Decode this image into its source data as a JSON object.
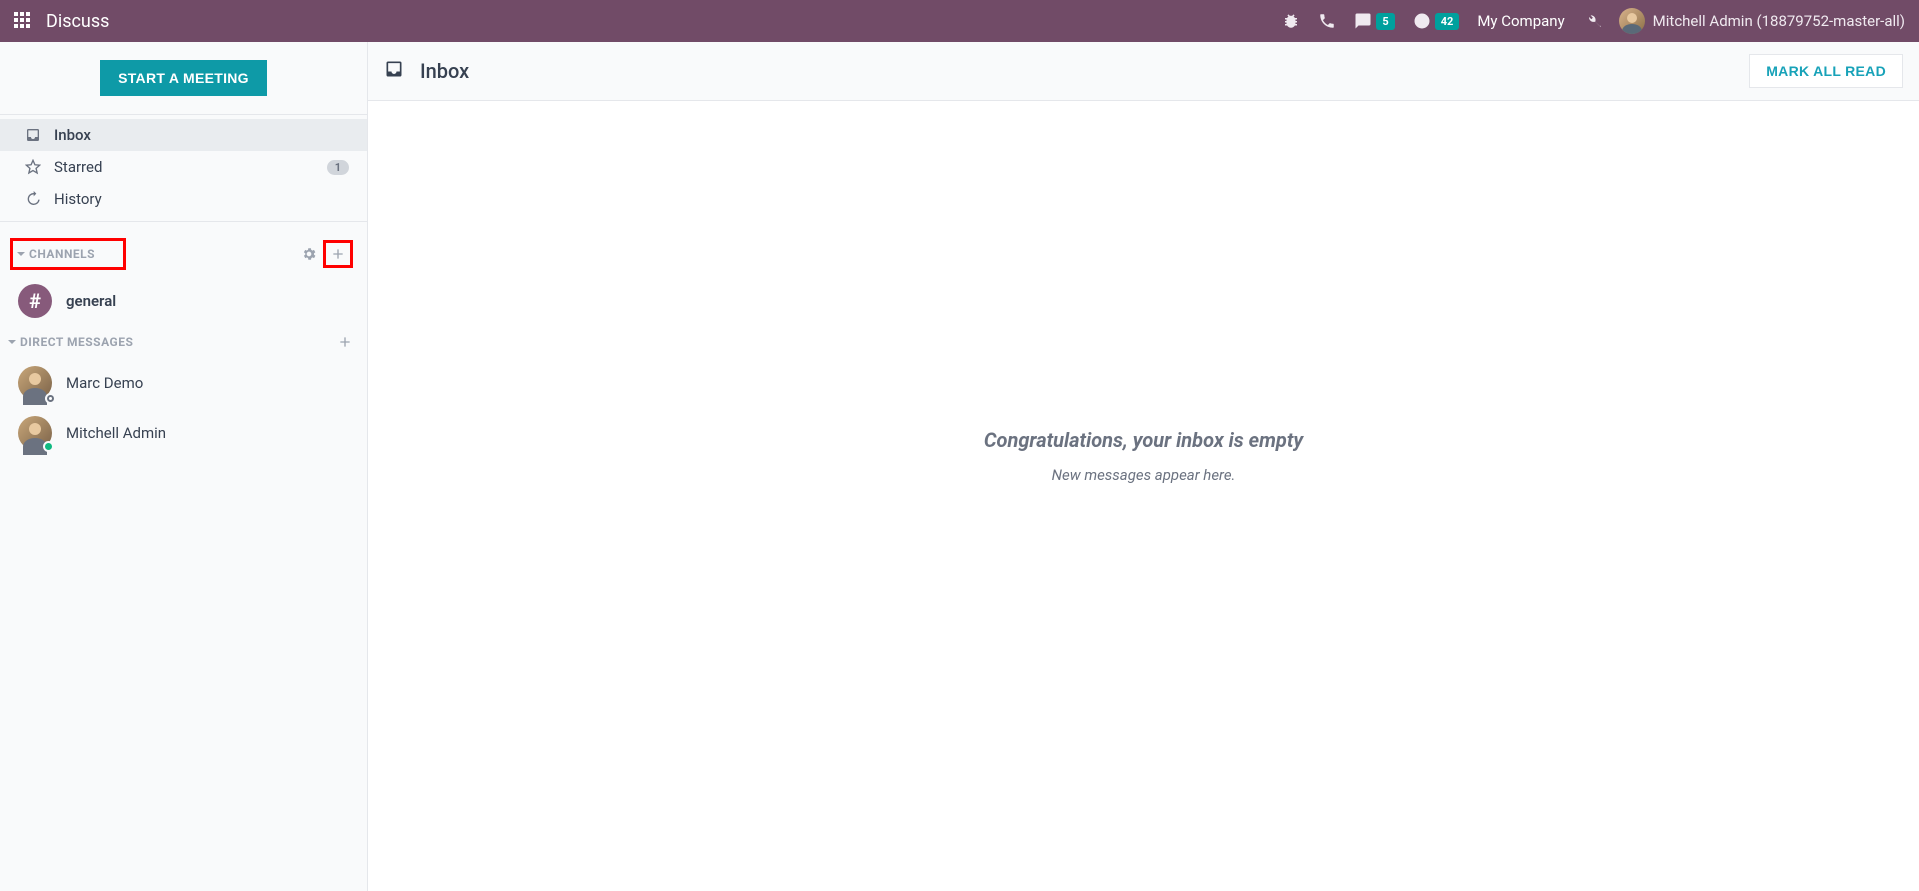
{
  "topnav": {
    "app_title": "Discuss",
    "messages_badge": "5",
    "activities_badge": "42",
    "company": "My Company",
    "user": "Mitchell Admin (18879752-master-all)"
  },
  "sidebar": {
    "start_meeting_label": "START A MEETING",
    "mailboxes": {
      "inbox": "Inbox",
      "starred": "Starred",
      "starred_count": "1",
      "history": "History"
    },
    "channels_header": "CHANNELS",
    "channels": [
      {
        "name": "general"
      }
    ],
    "dm_header": "DIRECT MESSAGES",
    "dms": [
      {
        "name": "Marc Demo",
        "presence": "offline"
      },
      {
        "name": "Mitchell Admin",
        "presence": "online"
      }
    ]
  },
  "content": {
    "title": "Inbox",
    "mark_all_read": "MARK ALL READ",
    "empty_title": "Congratulations, your inbox is empty",
    "empty_sub": "New messages appear here."
  }
}
